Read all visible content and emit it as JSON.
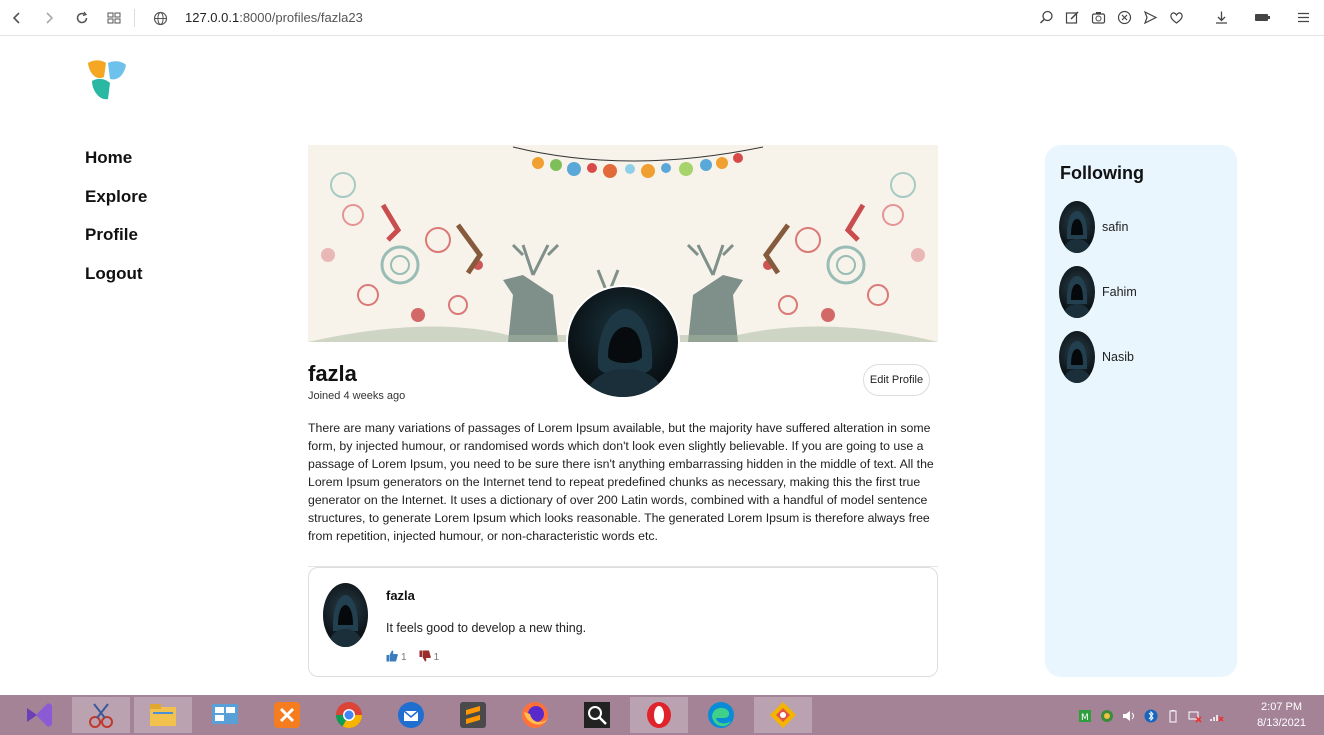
{
  "browser": {
    "url_host": "127.0.0.1",
    "url_path": ":8000/profiles/fazla23"
  },
  "nav": {
    "home": "Home",
    "explore": "Explore",
    "profile": "Profile",
    "logout": "Logout"
  },
  "profile": {
    "name": "fazla",
    "joined": "Joined 4 weeks ago",
    "edit_label": "Edit Profile",
    "bio": "There are many variations of passages of Lorem Ipsum available, but the majority have suffered alteration in some form, by injected humour, or randomised words which don't look even slightly believable. If you are going to use a passage of Lorem Ipsum, you need to be sure there isn't anything embarrassing hidden in the middle of text. All the Lorem Ipsum generators on the Internet tend to repeat predefined chunks as necessary, making this the first true generator on the Internet. It uses a dictionary of over 200 Latin words, combined with a handful of model sentence structures, to generate Lorem Ipsum which looks reasonable. The generated Lorem Ipsum is therefore always free from repetition, injected humour, or non-characteristic words etc."
  },
  "post": {
    "user": "fazla",
    "text": "It feels good to develop a new thing.",
    "likes": "1",
    "dislikes": "1"
  },
  "following": {
    "title": "Following",
    "users": [
      "safin",
      "Fahim",
      "Nasib"
    ]
  },
  "taskbar": {
    "time": "2:07 PM",
    "date": "8/13/2021"
  },
  "colors": {
    "following_bg": "#e9f6fd",
    "taskbar_bg": "#a48397",
    "like_color": "#3b7bbf",
    "dislike_color": "#9b2c2c"
  }
}
